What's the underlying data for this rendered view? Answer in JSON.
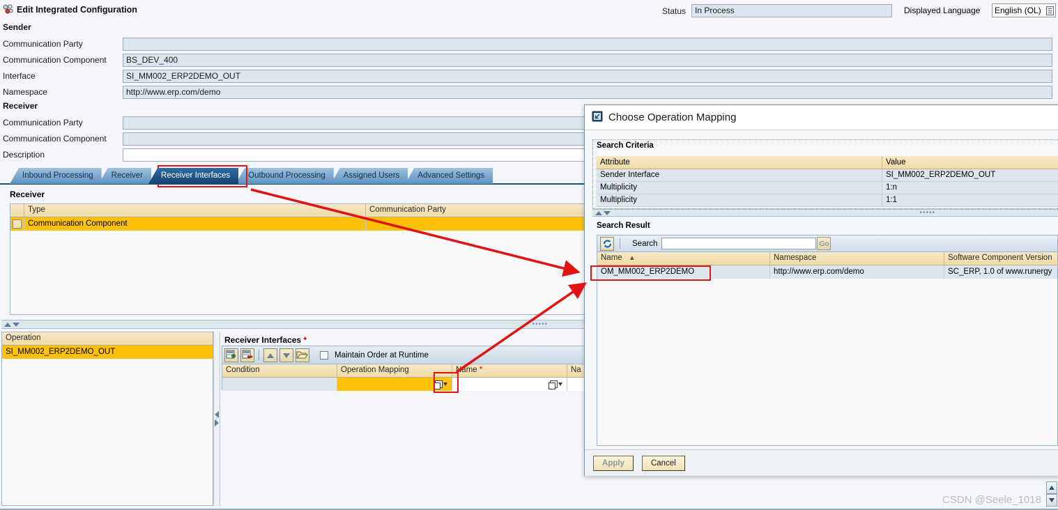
{
  "header": {
    "title": "Edit Integrated Configuration",
    "title_icon": "integrated-configuration-icon",
    "status_label": "Status",
    "status_value": "In Process",
    "language_label": "Displayed Language",
    "language_value": "English (OL)"
  },
  "sender": {
    "heading": "Sender",
    "rows": [
      {
        "label": "Communication Party",
        "value": ""
      },
      {
        "label": "Communication Component",
        "value": "BS_DEV_400"
      },
      {
        "label": "Interface",
        "value": "SI_MM002_ERP2DEMO_OUT"
      },
      {
        "label": "Namespace",
        "value": "http://www.erp.com/demo"
      }
    ]
  },
  "receiver_form": {
    "heading": "Receiver",
    "rows": [
      {
        "label": "Communication Party",
        "value": ""
      },
      {
        "label": "Communication Component",
        "value": ""
      },
      {
        "label": "Description",
        "value": ""
      }
    ]
  },
  "tabs": [
    {
      "label": "Inbound Processing",
      "active": false
    },
    {
      "label": "Receiver",
      "active": false
    },
    {
      "label": "Receiver Interfaces",
      "active": true
    },
    {
      "label": "Outbound Processing",
      "active": false
    },
    {
      "label": "Assigned Users",
      "active": false
    },
    {
      "label": "Advanced Settings",
      "active": false
    }
  ],
  "receiver_table": {
    "title": "Receiver",
    "columns": [
      "Type",
      "Communication Party"
    ],
    "rows": [
      {
        "type": "Communication Component",
        "party": ""
      }
    ]
  },
  "operation_panel": {
    "column": "Operation",
    "rows": [
      "SI_MM002_ERP2DEMO_OUT"
    ]
  },
  "receiver_interfaces": {
    "title": "Receiver Interfaces",
    "required_marker": "*",
    "toolbar": {
      "insert_row_icon": "insert-row-icon",
      "delete_row_icon": "delete-row-icon",
      "move_up_icon": "move-up-icon",
      "move_down_icon": "move-down-icon",
      "open_icon": "open-folder-icon",
      "checkbox_label": "Maintain Order at Runtime",
      "checkbox_checked": false
    },
    "columns": [
      "Condition",
      "Operation Mapping",
      "Name",
      "Na"
    ],
    "rows": [
      {
        "condition": "",
        "operation_mapping": "",
        "name": "",
        "na": ""
      }
    ]
  },
  "dialog": {
    "title": "Choose Operation Mapping",
    "title_icon": "choose-object-icon",
    "search_criteria": {
      "caption": "Search Criteria",
      "columns": [
        "Attribute",
        "Value"
      ],
      "rows": [
        {
          "attribute": "Sender Interface",
          "value": "SI_MM002_ERP2DEMO_OUT"
        },
        {
          "attribute": "Multiplicity",
          "value": "1:n"
        },
        {
          "attribute": "Multiplicity",
          "value": "1:1"
        }
      ]
    },
    "search_result": {
      "caption": "Search Result",
      "refresh_icon": "refresh-icon",
      "search_label": "Search",
      "search_value": "",
      "go_label": "Go",
      "columns": [
        "Name",
        "Namespace",
        "Software Component Version"
      ],
      "sort_indicator": "▲",
      "rows": [
        {
          "name": "OM_MM002_ERP2DEMO",
          "namespace": "http://www.erp.com/demo",
          "scv": "SC_ERP, 1.0 of www.runergy"
        }
      ]
    },
    "buttons": {
      "apply": "Apply",
      "apply_disabled": true,
      "cancel": "Cancel"
    }
  },
  "footer": {
    "watermark": "CSDN @Seele_1018",
    "scroll_up_icon": "scroll-up-icon",
    "scroll_down_icon": "scroll-down-icon"
  },
  "annotations": {
    "accent_color": "#e11414",
    "highlights": [
      "receiver-interfaces-tab",
      "operation-mapping-f4-help",
      "search-result-row"
    ]
  }
}
